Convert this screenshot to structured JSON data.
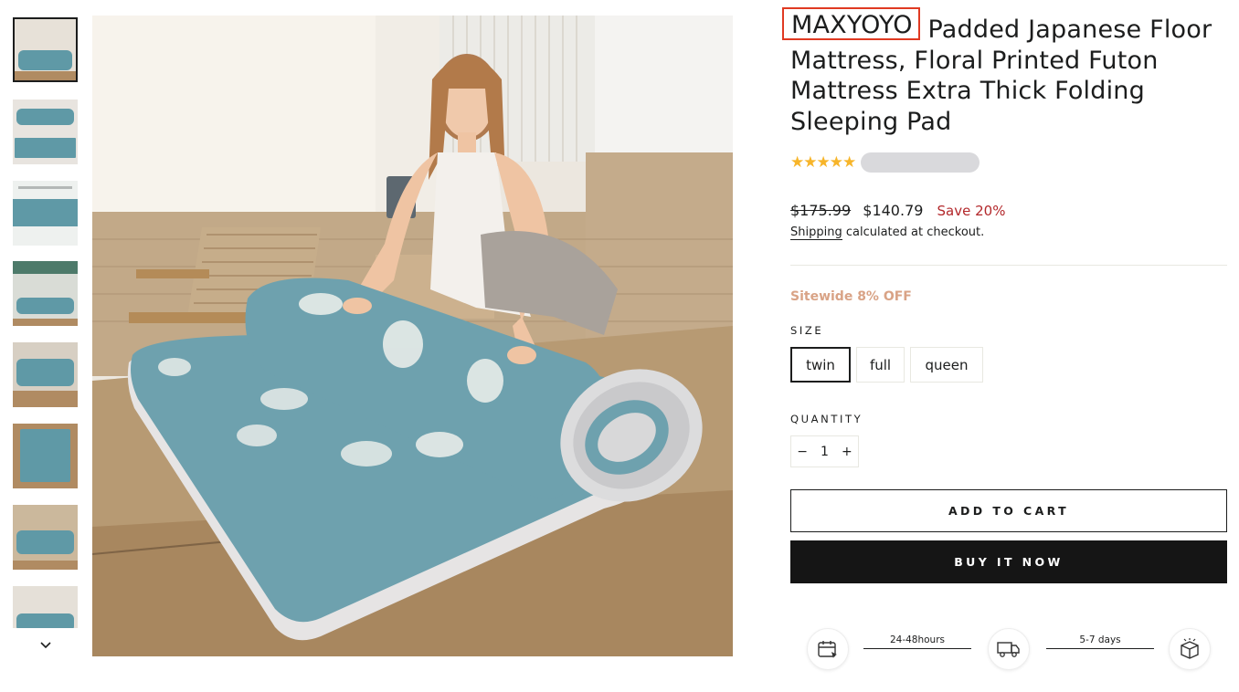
{
  "gallery": {
    "thumbnail_count": 8,
    "thumbnails": [
      "thumbnail-1",
      "thumbnail-2",
      "thumbnail-3",
      "thumbnail-4",
      "thumbnail-5",
      "thumbnail-6",
      "thumbnail-7",
      "thumbnail-8"
    ],
    "active_index": 0,
    "scroll_icon": "chevron-down-icon"
  },
  "product": {
    "brand": "MAXYOYO",
    "title_rest": " Padded Japanese Floor Mattress, Floral Printed Futon Mattress Extra Thick Folding Sleeping Pad",
    "rating_stars": "★★★★★",
    "rating_value": 4.5,
    "old_price": "$175.99",
    "new_price": "$140.79",
    "save_label": "Save 20%",
    "shipping_link": "Shipping",
    "shipping_rest": " calculated at checkout.",
    "promo": "Sitewide 8% OFF"
  },
  "size": {
    "label": "SIZE",
    "options": [
      "twin",
      "full",
      "queen"
    ],
    "selected": "twin"
  },
  "quantity": {
    "label": "QUANTITY",
    "minus": "−",
    "value": "1",
    "plus": "+"
  },
  "actions": {
    "add_to_cart": "ADD TO CART",
    "buy_now": "BUY IT NOW"
  },
  "delivery": {
    "segment1": "24-48hours",
    "segment2": "5-7 days",
    "icons": [
      "calendar-icon",
      "truck-icon",
      "package-icon"
    ]
  },
  "colors": {
    "accent_sale": "#b3282b",
    "promo": "#d9a386",
    "star": "#f7b52a",
    "highlight_box": "#e03a22"
  }
}
